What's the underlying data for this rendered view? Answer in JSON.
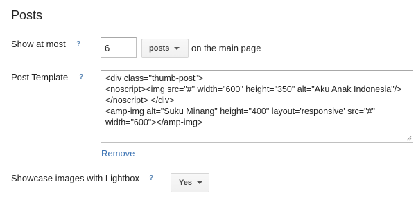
{
  "section": {
    "title": "Posts"
  },
  "show_at_most": {
    "label": "Show at most",
    "help": "?",
    "value": "6",
    "unit_option": "posts",
    "suffix": "on the main page"
  },
  "post_template": {
    "label": "Post Template",
    "help": "?",
    "value": "<div class=\"thumb-post\">\n<noscript><img src=\"#\" width=\"600\" height=\"350\" alt=\"Aku Anak Indonesia\"/></noscript> </div>\n<amp-img alt=\"Suku Minang\" height=\"400\" layout='responsive' src=\"#\" width=\"600\"></amp-img>",
    "remove_label": "Remove"
  },
  "lightbox": {
    "label": "Showcase images with Lightbox",
    "help": "?",
    "selected": "Yes"
  },
  "colors": {
    "link": "#3a72b3",
    "help_icon": "#5b87b5",
    "border": "#c0c0c0"
  }
}
